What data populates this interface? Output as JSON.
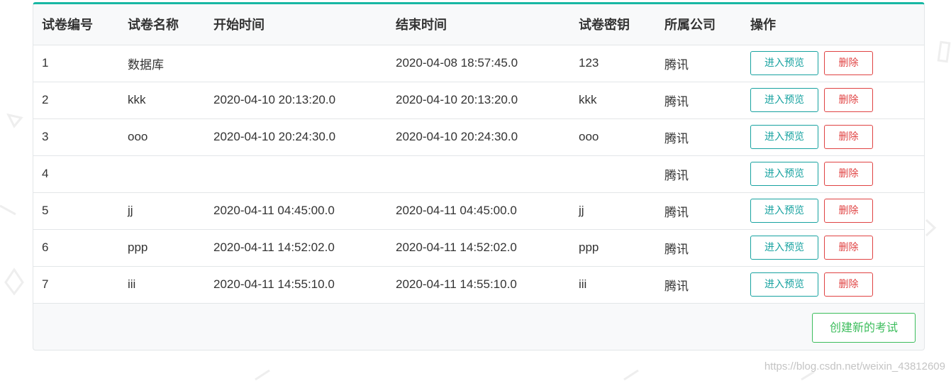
{
  "table": {
    "columns": [
      "试卷编号",
      "试卷名称",
      "开始时间",
      "结束时间",
      "试卷密钥",
      "所属公司",
      "操作"
    ],
    "rows": [
      {
        "id": "1",
        "name": "数据库",
        "start": "",
        "end": "2020-04-08 18:57:45.0",
        "key": "123",
        "company": "腾讯"
      },
      {
        "id": "2",
        "name": "kkk",
        "start": "2020-04-10 20:13:20.0",
        "end": "2020-04-10 20:13:20.0",
        "key": "kkk",
        "company": "腾讯"
      },
      {
        "id": "3",
        "name": "ooo",
        "start": "2020-04-10 20:24:30.0",
        "end": "2020-04-10 20:24:30.0",
        "key": "ooo",
        "company": "腾讯"
      },
      {
        "id": "4",
        "name": "",
        "start": "",
        "end": "",
        "key": "",
        "company": "腾讯"
      },
      {
        "id": "5",
        "name": "jj",
        "start": "2020-04-11 04:45:00.0",
        "end": "2020-04-11 04:45:00.0",
        "key": "jj",
        "company": "腾讯"
      },
      {
        "id": "6",
        "name": "ppp",
        "start": "2020-04-11 14:52:02.0",
        "end": "2020-04-11 14:52:02.0",
        "key": "ppp",
        "company": "腾讯"
      },
      {
        "id": "7",
        "name": "iii",
        "start": "2020-04-11 14:55:10.0",
        "end": "2020-04-11 14:55:10.0",
        "key": "iii",
        "company": "腾讯"
      }
    ],
    "preview_label": "进入预览",
    "delete_label": "删除"
  },
  "footer": {
    "create_label": "创建新的考试"
  },
  "watermark": "https://blog.csdn.net/weixin_43812609",
  "colors": {
    "accent": "#18b7a3",
    "preview": "#17a2a0",
    "delete": "#e04343",
    "create": "#3cbd5c"
  }
}
